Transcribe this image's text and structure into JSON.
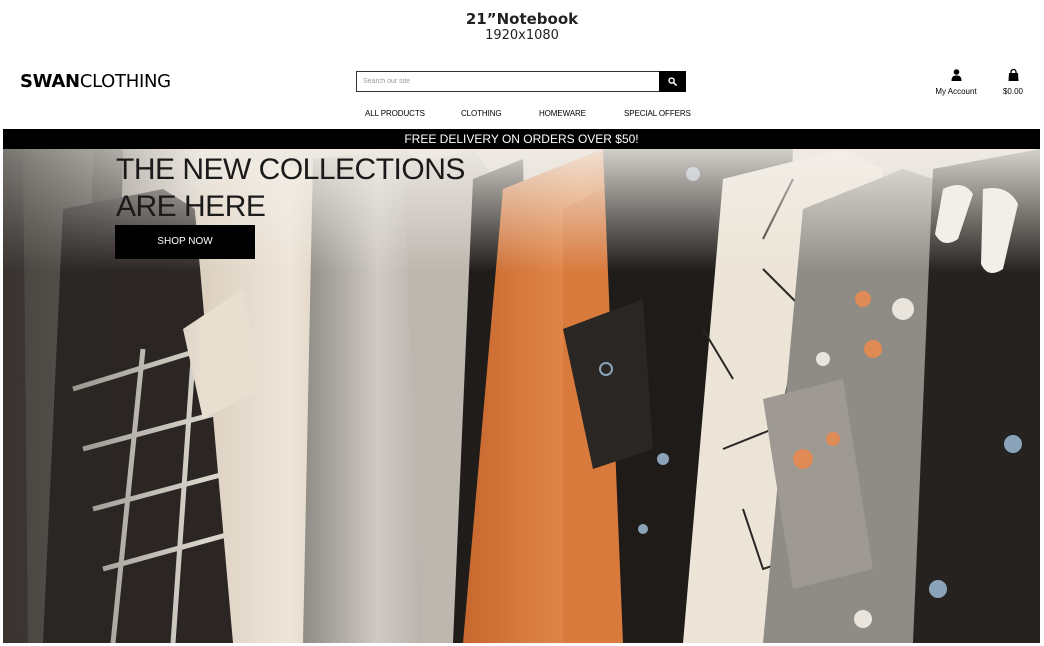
{
  "caption": {
    "device": "21”Notebook",
    "resolution": "1920x1080"
  },
  "header": {
    "logo_bold": "SWAN",
    "logo_regular": "CLOTHING",
    "search_placeholder": "Search our site",
    "search_icon": "search-icon",
    "account_label": "My Account",
    "account_icon": "user-icon",
    "cart_total": "$0.00",
    "cart_icon": "shopping-bag-icon"
  },
  "nav": {
    "items": [
      "ALL PRODUCTS",
      "CLOTHING",
      "HOMEWARE",
      "SPECIAL OFFERS"
    ]
  },
  "banner": {
    "text": "FREE DELIVERY ON ORDERS OVER $50!"
  },
  "hero": {
    "title": "THE NEW COLLECTIONS\nARE HERE",
    "button_label": "SHOP NOW"
  },
  "colors": {
    "brand": "#000000",
    "background": "#ffffff",
    "banner_text": "#ffffff"
  }
}
